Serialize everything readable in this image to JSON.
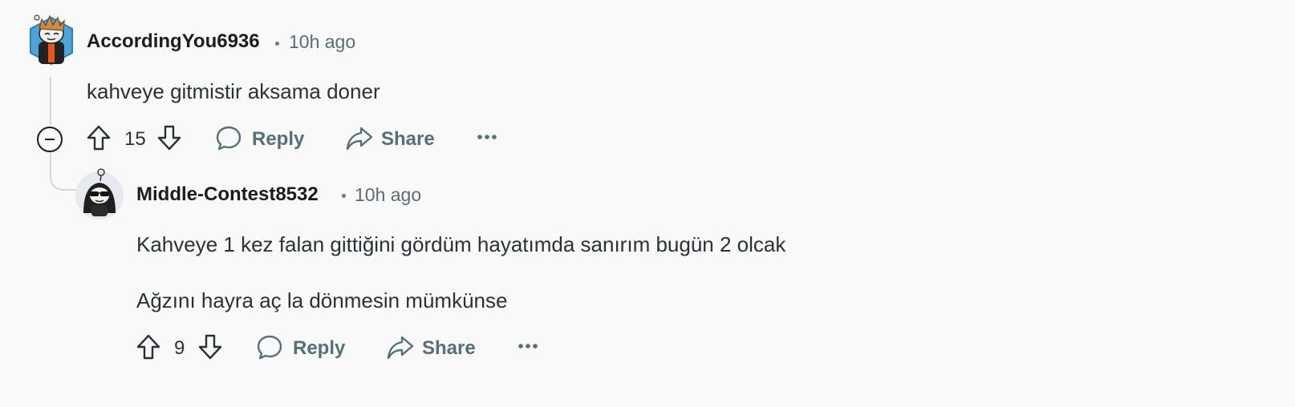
{
  "comments": [
    {
      "author": "AccordingYou6936",
      "time": "10h ago",
      "body_lines": [
        "kahveye gitmistir aksama doner"
      ],
      "votes": "15",
      "reply_label": "Reply",
      "share_label": "Share"
    },
    {
      "author": "Middle-Contest8532",
      "time": "10h ago",
      "body_lines": [
        "Kahveye 1 kez falan gittiğini gördüm hayatımda sanırım bugün 2 olcak",
        "Ağzını hayra aç la dönmesin mümkünse"
      ],
      "votes": "9",
      "reply_label": "Reply",
      "share_label": "Share"
    }
  ],
  "icons": {
    "upvote": "arrow-up-icon",
    "downvote": "arrow-down-icon",
    "reply": "speech-bubble-icon",
    "share": "share-arrow-icon",
    "more": "ellipsis-icon",
    "collapse": "minus-circle-icon"
  },
  "colors": {
    "background": "#f9f9fa",
    "thread_line": "#d4d7da",
    "action_text": "#576f76",
    "time_text": "#5c6c74"
  }
}
